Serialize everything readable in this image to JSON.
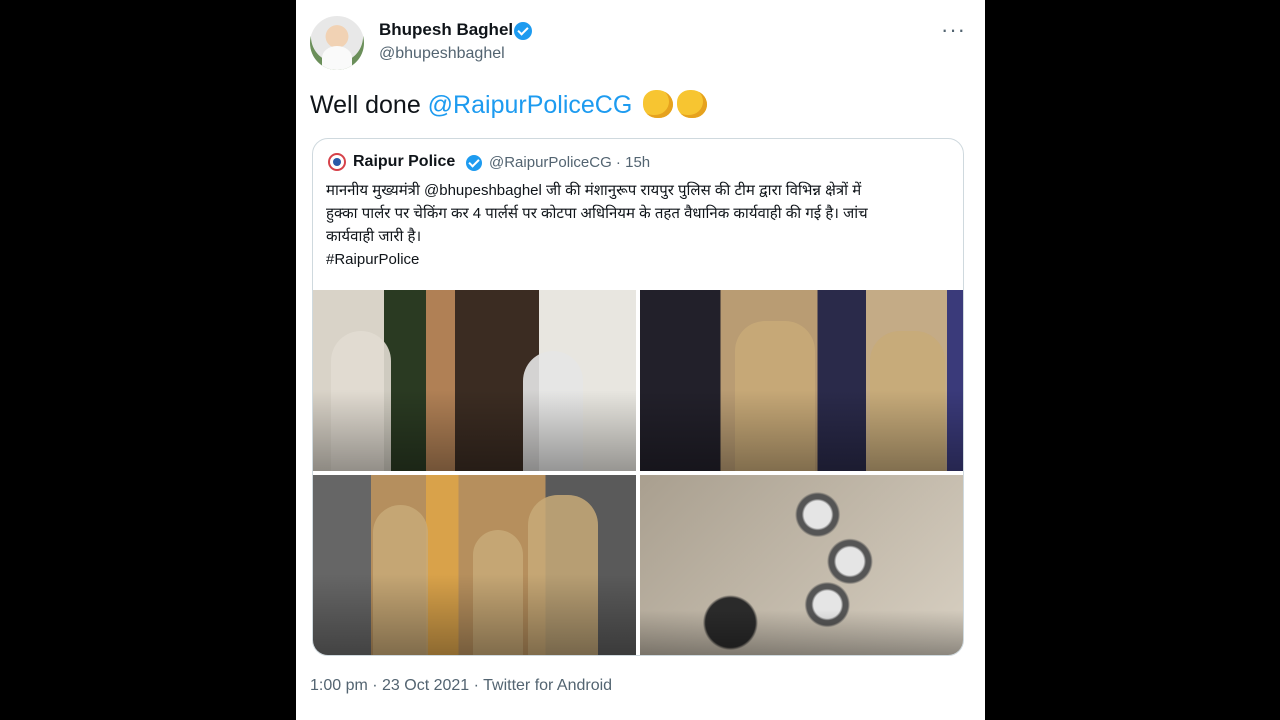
{
  "author": {
    "name": "Bhupesh Baghel",
    "handle": "@bhupeshbaghel",
    "more_label": "···"
  },
  "tweet": {
    "text_prefix": "Well done ",
    "mention": "@RaipurPoliceCG",
    "emoji": [
      "clapping-hands",
      "clapping-hands"
    ]
  },
  "quoted": {
    "name": "Raipur Police",
    "meta": "@RaipurPoliceCG · 15h",
    "lines": [
      "माननीय मुख्यमंत्री @bhupeshbaghel जी की मंशानुरूप रायपुर पुलिस की टीम द्वारा विभिन्न क्षेत्रों में",
      "हुक्का पार्लर पर चेकिंग कर 4 पार्लर्स पर कोटपा अधिनियम के तहत वैधानिक कार्यवाही की गई है। जांच",
      "कार्यवाही जारी है।",
      "#RaipurPolice"
    ],
    "photos": [
      "police-raid-photo-1",
      "police-raid-photo-2",
      "police-raid-photo-3",
      "hookah-equipment-photo"
    ]
  },
  "footer": "1:00 pm · 23 Oct 2021 · Twitter for Android",
  "colors": {
    "accent": "#1d9bf0",
    "text": "#0f1419",
    "muted": "#536471",
    "border": "#cfd9de"
  }
}
